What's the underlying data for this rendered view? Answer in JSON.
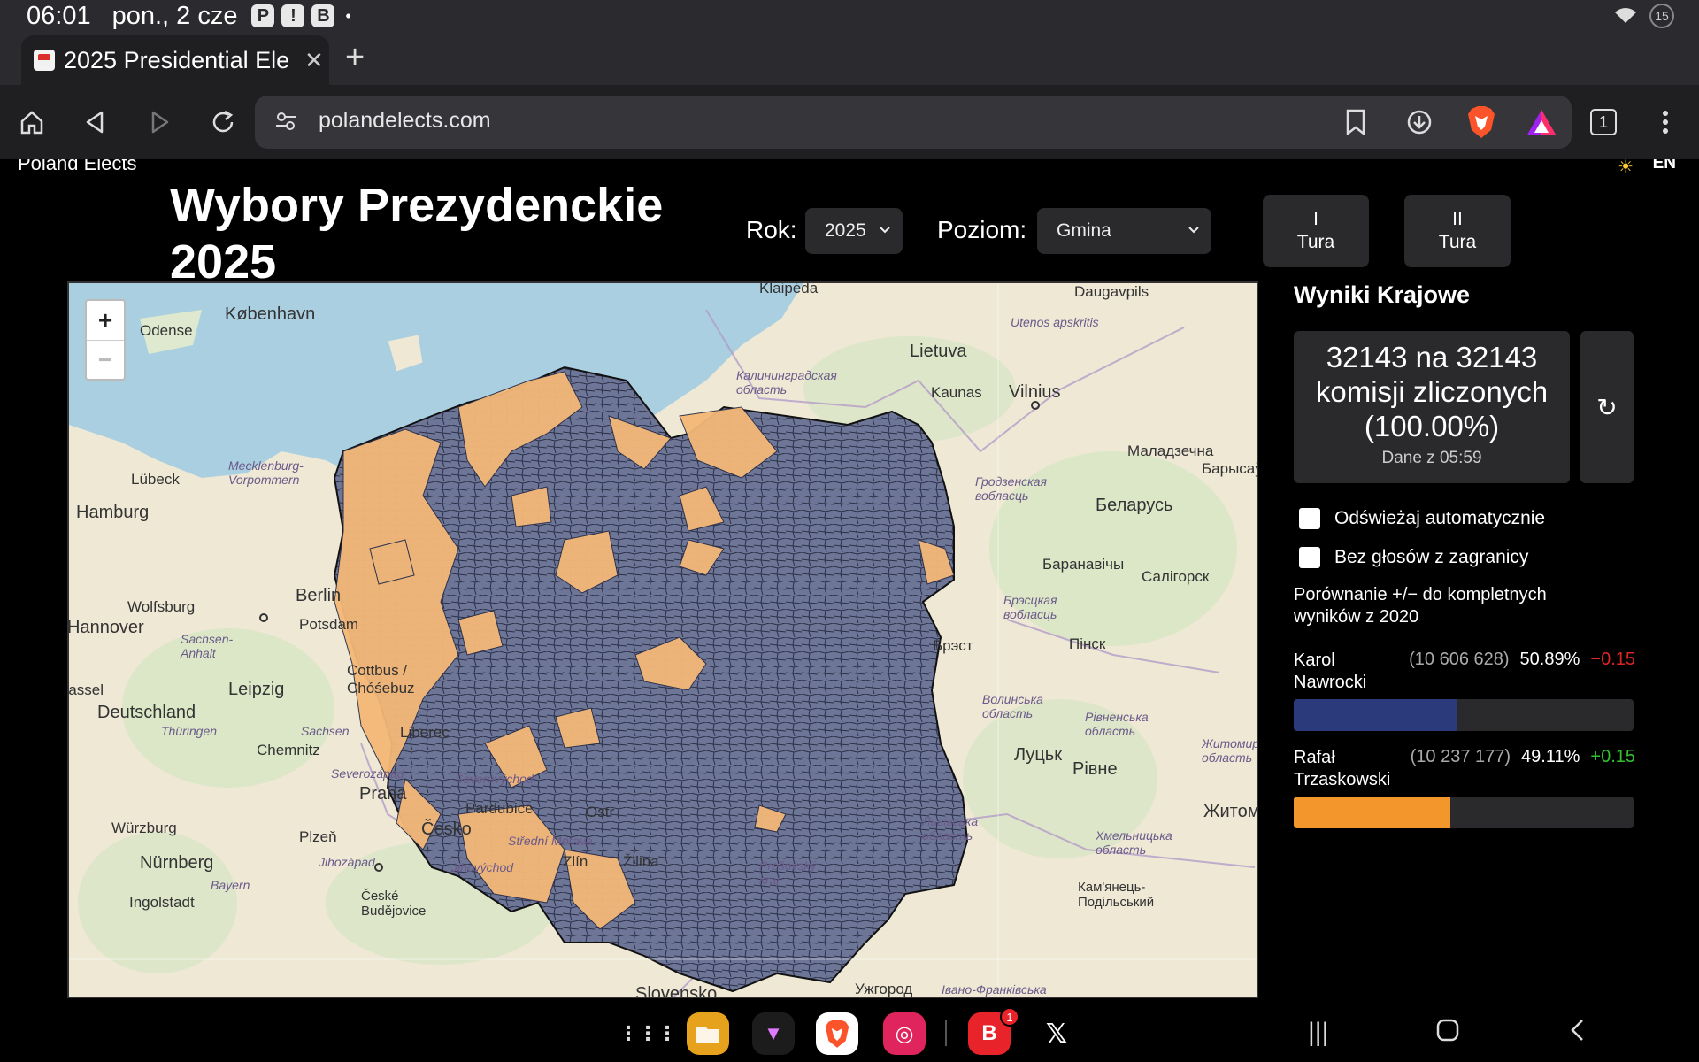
{
  "status_bar": {
    "time": "06:01",
    "date": "pon., 2 cze",
    "battery": "15"
  },
  "browser": {
    "tab_title": "2025 Presidential Ele",
    "url": "polandelects.com",
    "tab_count": "1",
    "colors": {
      "brave_orange": "#fb542b"
    }
  },
  "site": {
    "brand": "Poland Elects",
    "lang": "EN"
  },
  "header": {
    "title": "Wybory Prezydenckie 2025",
    "year_label": "Rok:",
    "year_value": "2025",
    "level_label": "Poziom:",
    "level_value": "Gmina",
    "round1_line1": "I",
    "round1_line2": "Tura",
    "round2_line1": "II",
    "round2_line2": "Tura"
  },
  "map": {
    "zoom_in": "+",
    "zoom_out": "−",
    "labels": {
      "klaipeda": "Klaipėda",
      "daugavpils": "Daugavpils",
      "utenos": "Utenos apskritis",
      "kobenhavn": "København",
      "odense": "Odense",
      "lietuva": "Lietuva",
      "kaliningrad": "Калининградская область",
      "kaunas": "Kaunas",
      "vilnius": "Vilnius",
      "malodzechna": "Маладзечна",
      "mecklenburg": "Mecklenburg-Vorpommern",
      "lubeck": "Lübeck",
      "hamburg": "Hamburg",
      "hrodna": "Гродзенская вобласць",
      "belarus": "Беларусь",
      "baranavichy": "Баранавічы",
      "salihorsk": "Салігорск",
      "berlin": "Berlin",
      "wolfsburg": "Wolfsburg",
      "potsdam": "Potsdam",
      "hannover": "Hannover",
      "sachsen_anhalt": "Sachsen-Anhalt",
      "brest_obl": "Брэсцкая вобласць",
      "pinsk": "Пінск",
      "leipzig": "Leipzig",
      "cottbus": "Cottbus / Chóśebuz",
      "deutschland": "Deutschland",
      "thuringen": "Thüringen",
      "sachsen": "Sachsen",
      "chemnitz": "Chemnitz",
      "volyn": "Волинська область",
      "rivne_obl": "Рівненська область",
      "lutsk": "Луцьк",
      "rivne": "Рівне",
      "severozapad": "Severozápad",
      "praha": "Praha",
      "severovychod": "Severovýchod",
      "pardubice": "Pardubice",
      "cesko": "Česko",
      "stredni_morava": "Střední Morava",
      "wurzburg": "Würzburg",
      "plzen": "Plzeň",
      "nurnberg": "Nürnberg",
      "jihozapad": "Jihozápad",
      "jihovychod": "Jihovýchod",
      "zlin": "Zlín",
      "zilina": "Žilina",
      "presovsky": "Prešovský kraj",
      "lviv_obl": "Львівська область",
      "khmelnytskyi_obl": "Хмельницька область",
      "zhytomyr_obl": "Житомирська область",
      "zhytom": "Житом",
      "kamyanets": "Кам'янець-Подільський",
      "bayern": "Bayern",
      "ingolstadt": "Ingolstadt",
      "ceske_budejovice": "České Budějovice",
      "slovensko": "Slovensko",
      "uzhhorod": "Ужгород",
      "ivano_frank": "Івано-Франківська",
      "ostrava": "Ostr",
      "liberec": "Liberec",
      "kassel": "Kassel",
      "brest": "Брэст",
      "baranov": "Барысаў"
    }
  },
  "results": {
    "title": "Wyniki Krajowe",
    "count_line": "32143 na 32143 komisji zliczonych (100.00%)",
    "updated": "Dane z 05:59",
    "refresh_symbol": "↻",
    "auto_refresh_label": "Odświeżaj automatycznie",
    "no_abroad_label": "Bez głosów z zagranicy",
    "compare_note": "Porównanie +/− do kompletnych wyników z 2020",
    "candidates": [
      {
        "first": "Karol",
        "last": "Nawrocki",
        "votes": "(10 606 628)",
        "pct": "50.89%",
        "delta": "−0.15",
        "share": 0.5089,
        "color": "#2b3a7a"
      },
      {
        "first": "Rafał",
        "last": "Trzaskowski",
        "votes": "(10 237 177)",
        "pct": "49.11%",
        "delta": "+0.15",
        "share": 0.4911,
        "color": "#f3962c"
      }
    ]
  }
}
